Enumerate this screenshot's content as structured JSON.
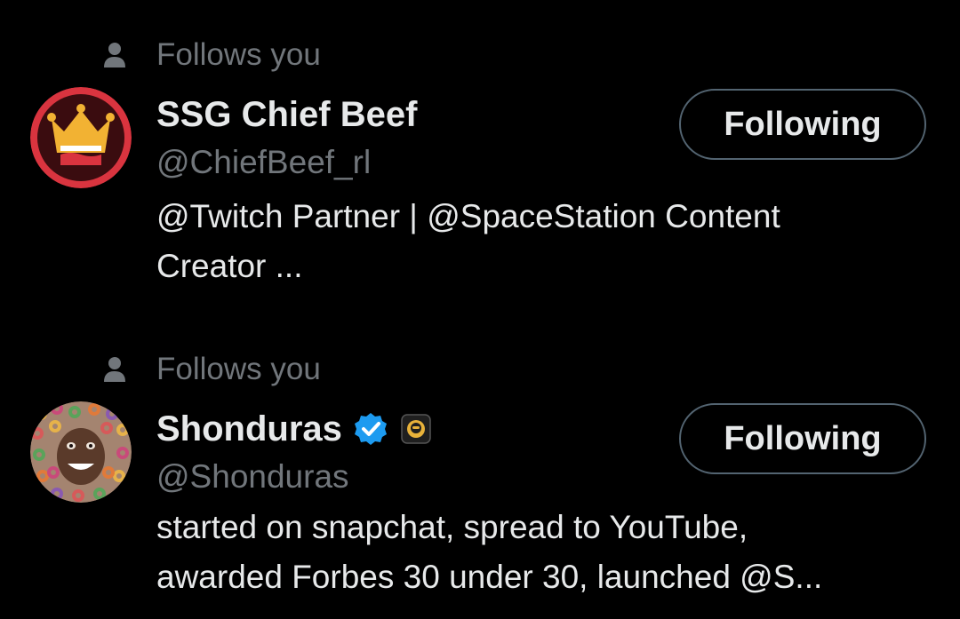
{
  "accent": "#1d9bf0",
  "users": [
    {
      "follows_label": "Follows you",
      "name": "SSG Chief Beef",
      "handle": "@ChiefBeef_rl",
      "bio_line1": "@Twitch Partner | @SpaceStation Content",
      "bio_line2": "Creator ...",
      "button_label": "Following",
      "verified": false,
      "avatar_icon": "crown-logo"
    },
    {
      "follows_label": "Follows you",
      "name": "Shonduras",
      "handle": "@Shonduras",
      "bio_line1": "started on snapchat, spread to YouTube,",
      "bio_line2": "awarded Forbes 30 under 30, launched @S...",
      "button_label": "Following",
      "verified": true,
      "avatar_icon": "face-photo"
    }
  ]
}
